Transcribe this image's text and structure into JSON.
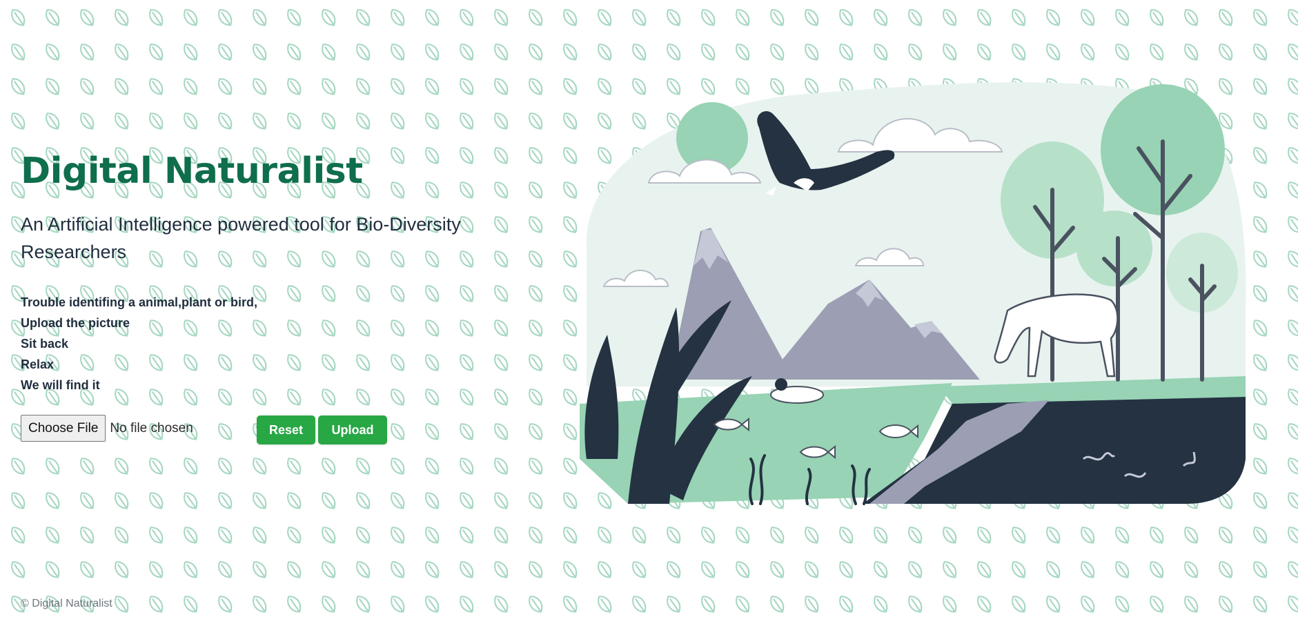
{
  "app": {
    "title": "Digital Naturalist",
    "subtitle": "An Artificial Intelligence powered tool for Bio-Diversity Researchers"
  },
  "steps": [
    "Trouble identifing a animal,plant or bird,",
    "Upload the picture",
    "Sit back",
    "Relax",
    "We will find it"
  ],
  "file_input": {
    "button_label": "Choose File",
    "status": "No file chosen"
  },
  "buttons": {
    "reset": "Reset",
    "upload": "Upload"
  },
  "footer": {
    "text": "© Digital Naturalist"
  },
  "colors": {
    "accent": "#0f6e4c",
    "button": "#28a745",
    "pattern_leaf": "#a8d8c2",
    "illustration_mint": "#97d3b4",
    "illustration_dark": "#243242",
    "illustration_gray": "#9c9fb3"
  },
  "icons": {
    "background_pattern": "leaf-icon"
  }
}
